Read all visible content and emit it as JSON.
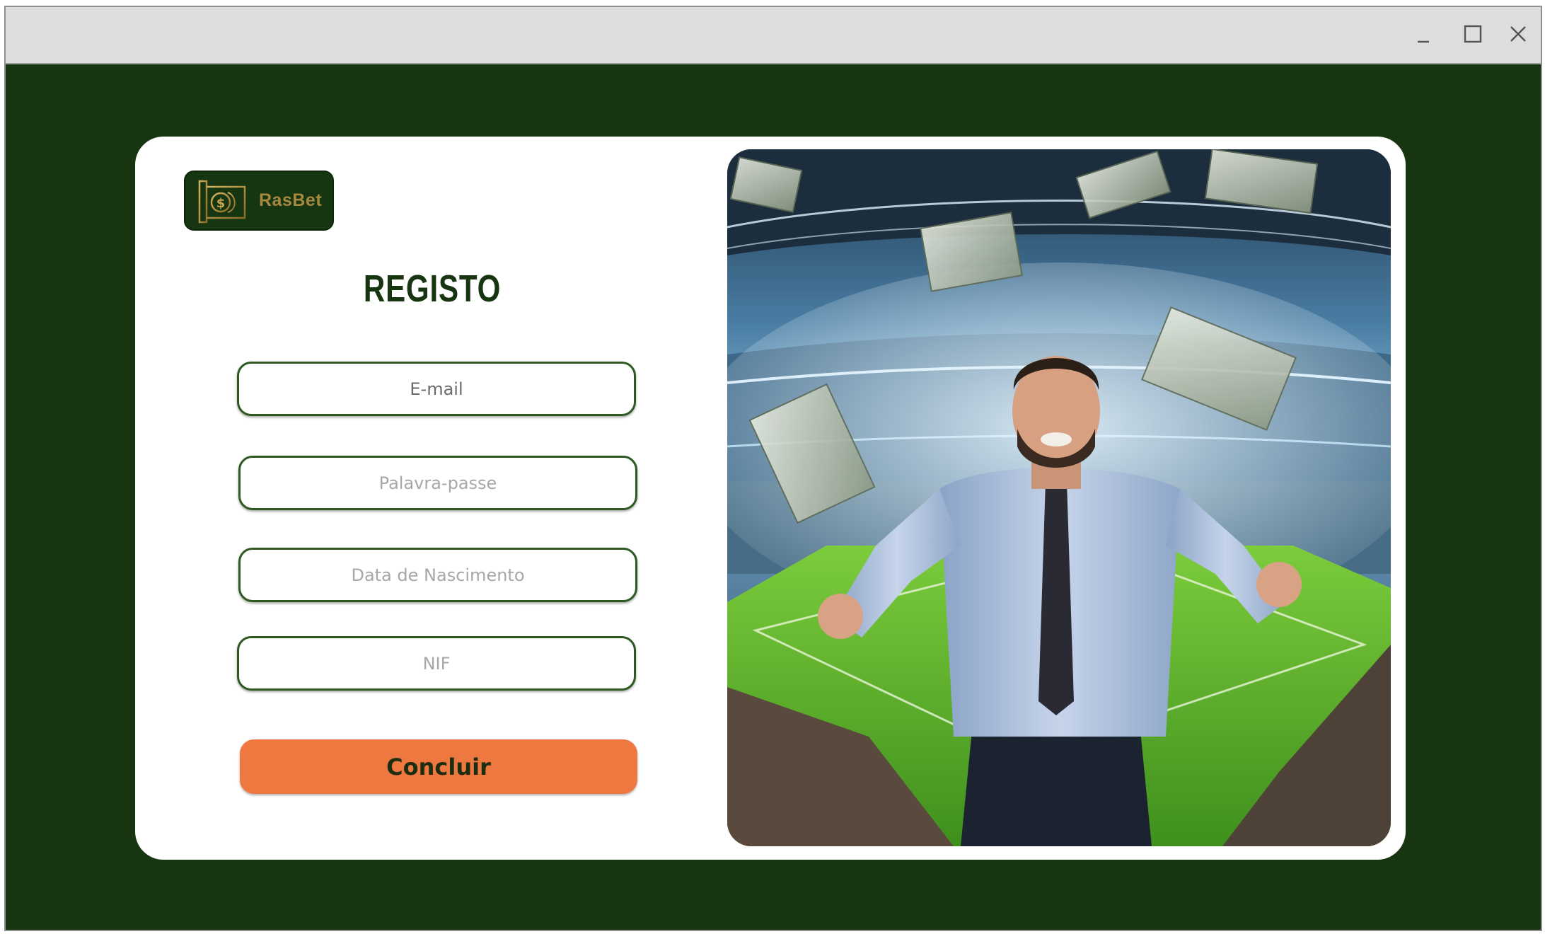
{
  "window": {
    "controls": {
      "minimize_icon": "minimize-icon",
      "maximize_icon": "maximize-icon",
      "close_icon": "close-icon"
    }
  },
  "logo": {
    "icon": "money-bill-icon",
    "text": "RasBet"
  },
  "form": {
    "title": "REGISTO",
    "email_placeholder": "E-mail",
    "password_placeholder": "Palavra-passe",
    "birthdate_placeholder": "Data de Nascimento",
    "nif_placeholder": "NIF",
    "submit_label": "Concluir"
  },
  "hero": {
    "description_icon": "celebrating-man-stadium-money-image"
  },
  "colors": {
    "background": "#173511",
    "card": "#ffffff",
    "accent": "#ef7840",
    "brand_gold": "#a8883e",
    "field_border": "#2e5a22"
  }
}
